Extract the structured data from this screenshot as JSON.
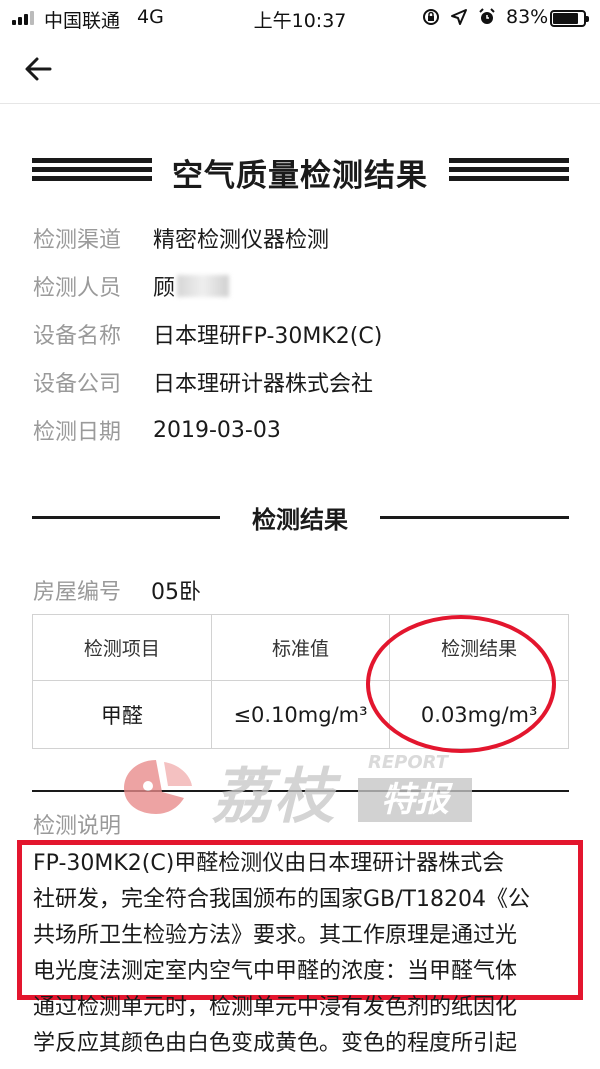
{
  "status_bar": {
    "carrier": "中国联通",
    "network": "4G",
    "time": "上午10:37",
    "battery_percent": "83%",
    "battery_level": 0.83,
    "icons": [
      "lock-rotation-icon",
      "location-arrow-icon",
      "alarm-icon"
    ]
  },
  "nav": {
    "back_icon": "arrow-left-icon"
  },
  "report": {
    "title": "空气质量检测结果",
    "info": [
      {
        "label": "检测渠道",
        "value": "精密检测仪器检测"
      },
      {
        "label": "检测人员",
        "value": "顾"
      },
      {
        "label": "设备名称",
        "value": "日本理研FP-30MK2(C)"
      },
      {
        "label": "设备公司",
        "value": "日本理研计器株式会社"
      },
      {
        "label": "检测日期",
        "value": "2019-03-03"
      }
    ],
    "section_title": "检测结果",
    "room_label": "房屋编号",
    "room_value": "05卧",
    "table": {
      "headers": [
        "检测项目",
        "标准值",
        "检测结果"
      ],
      "row": [
        "甲醛",
        "≤0.10mg/m³",
        "0.03mg/m³"
      ]
    },
    "description_label": "检测说明",
    "description_lines": [
      "FP-30MK2(C)甲醛检测仪由日本理研计器株式会",
      "社研发，完全符合我国颁布的国家GB/T18204《公",
      "共场所卫生检验方法》要求。其工作原理是通过光",
      "电光度法测定室内空气中甲醛的浓度：当甲醛气体",
      "通过检测单元时，检测单元中浸有发色剂的纸因化",
      "学反应其颜色由白色变成黄色。变色的程度所引起"
    ]
  },
  "watermark": {
    "brand": "荔枝",
    "report": "REPORT",
    "special": "特报"
  },
  "colors": {
    "highlight_red": "#e3162e",
    "label_gray": "#9a9a9a",
    "text_dark": "#1a1a1a"
  }
}
